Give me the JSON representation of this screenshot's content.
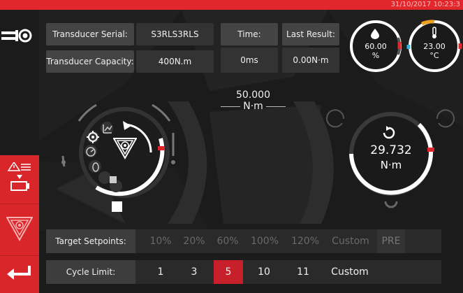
{
  "header": {
    "datetime": "31/10/2017 10:23:3"
  },
  "colors": {
    "accent": "#e1262c",
    "panel": "#3a3a3a",
    "background": "#1b1b1b"
  },
  "transducer": {
    "serial_label": "Transducer Serial:",
    "serial_value": "S3RLS3RLS",
    "capacity_label": "Transducer Capacity:",
    "capacity_value": "400N.m"
  },
  "time": {
    "label": "Time:",
    "value": "0ms"
  },
  "last_result": {
    "label": "Last Result:",
    "value": "0.00N·m"
  },
  "humidity": {
    "value": "60.00",
    "unit": "%"
  },
  "temperature": {
    "value": "23.00",
    "unit": "°C"
  },
  "target_torque": {
    "value": "50.000",
    "unit": "N·m"
  },
  "live_torque": {
    "value": "29.732",
    "unit": "N·m"
  },
  "target_setpoints": {
    "label": "Target Setpoints:",
    "options": [
      "10%",
      "20%",
      "60%",
      "100%",
      "120%",
      "Custom",
      "PRE"
    ]
  },
  "cycle_limit": {
    "label": "Cycle Limit:",
    "options": [
      "1",
      "3",
      "5",
      "10",
      "11",
      "Custom"
    ],
    "selected": "5"
  },
  "icons": {
    "transducer": "transducer-plug-icon",
    "humidity": "droplet-icon",
    "temperature": "thermometer-icon",
    "warning": "warning-download-icon",
    "logo": "triangle-target-logo-icon",
    "back": "return-arrow-icon",
    "stop": "stop-square-icon",
    "rotate": "rotate-arrow-icon"
  }
}
